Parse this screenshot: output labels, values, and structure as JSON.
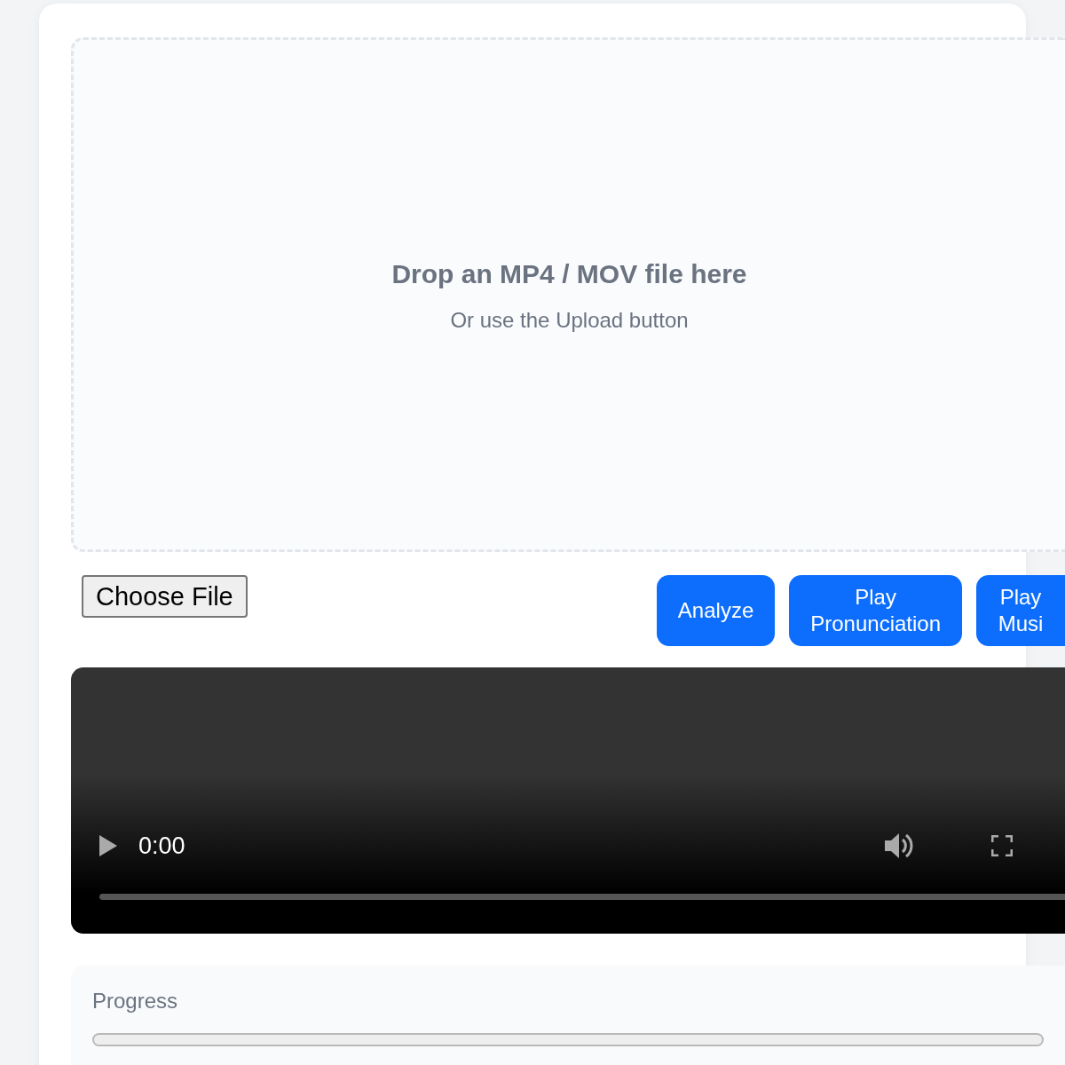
{
  "dropzone": {
    "title": "Drop an MP4 / MOV file here",
    "subtitle": "Or use the Upload button"
  },
  "file_button": {
    "label": "Choose File"
  },
  "buttons": [
    {
      "label": "Analyze"
    },
    {
      "label": "Play Pronunciation"
    },
    {
      "label": "Play Musi"
    }
  ],
  "video": {
    "time": "0:00"
  },
  "progress": {
    "label": "Progress",
    "level": 0
  }
}
